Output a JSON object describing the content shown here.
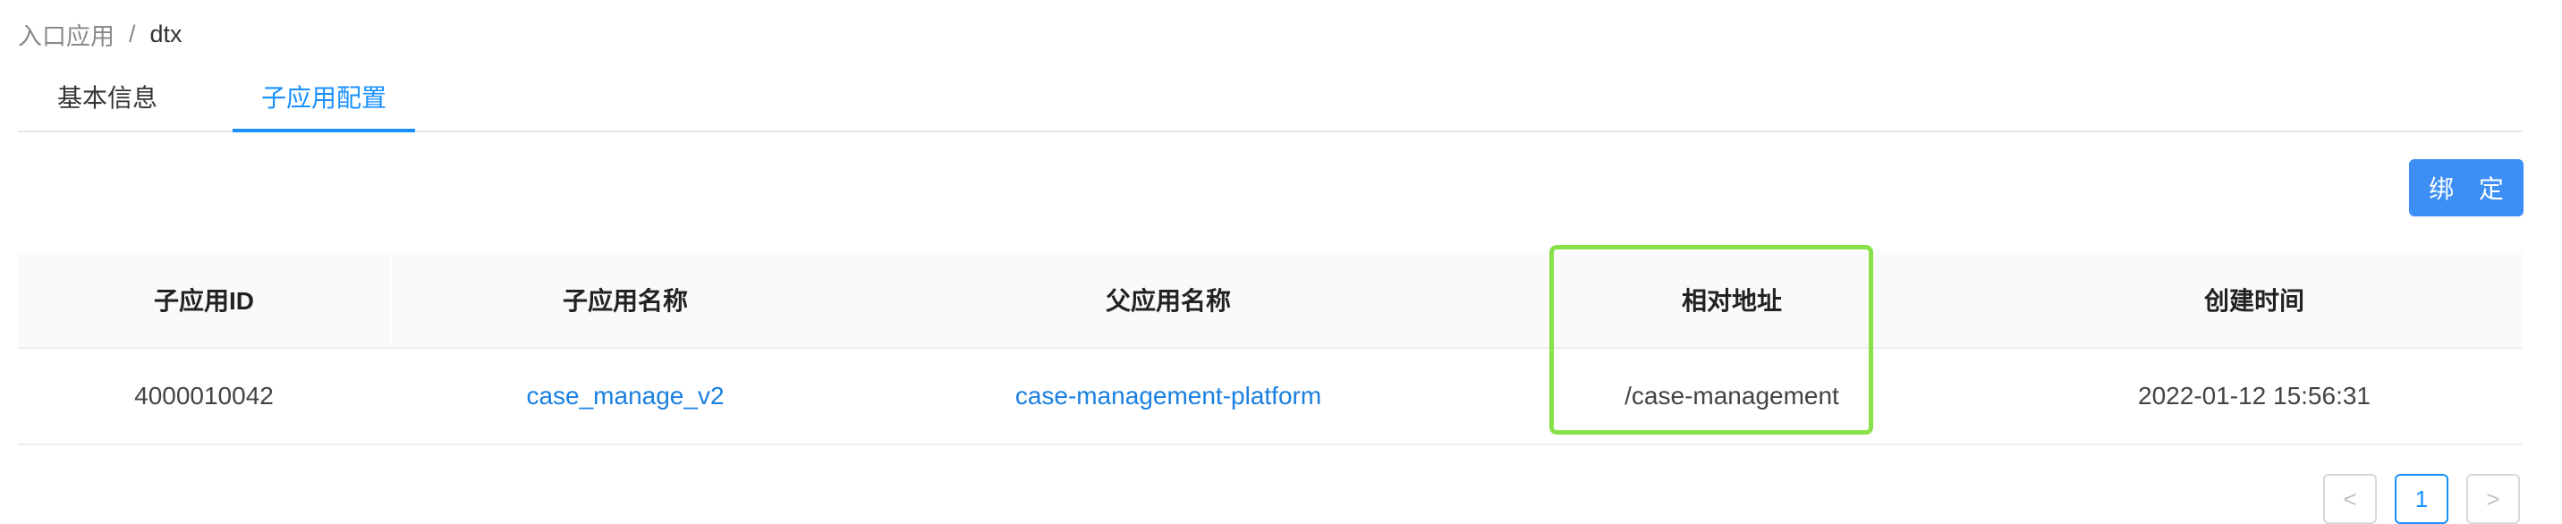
{
  "breadcrumb": {
    "root": "入口应用",
    "separator": "/",
    "current": "dtx"
  },
  "tabs": [
    {
      "label": "基本信息",
      "active": false
    },
    {
      "label": "子应用配置",
      "active": true
    }
  ],
  "toolbar": {
    "bind_label": "绑 定"
  },
  "table": {
    "columns": [
      "子应用ID",
      "子应用名称",
      "父应用名称",
      "相对地址",
      "创建时间"
    ],
    "rows": [
      {
        "id": "4000010042",
        "sub_name": "case_manage_v2",
        "parent_name": "case-management-platform",
        "relative_path": "/case-management",
        "created_at": "2022-01-12 15:56:31"
      }
    ]
  },
  "pagination": {
    "prev": "<",
    "current_page": "1",
    "next": ">"
  },
  "colors": {
    "accent": "#1890ff",
    "highlight": "#88e04a"
  }
}
